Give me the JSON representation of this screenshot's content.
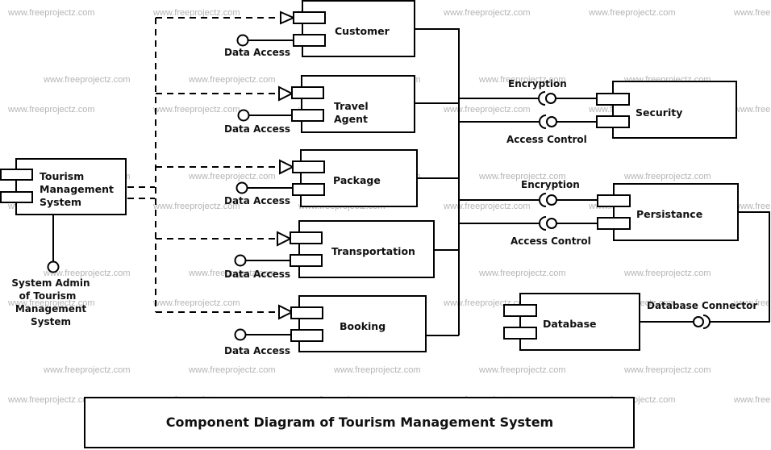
{
  "diagram": {
    "title": "Component Diagram of Tourism Management System",
    "watermark": "www.freeprojectz.com",
    "colors": {
      "line": "#000000",
      "background": "#ffffff",
      "watermark": "#b5b5b5"
    },
    "system": {
      "name_lines": [
        "Tourism",
        "Management",
        "System"
      ],
      "provided_interface_lines": [
        "System Admin",
        "of Tourism",
        "Management",
        "System"
      ]
    },
    "modules": [
      {
        "id": "customer",
        "name_lines": [
          "Customer"
        ],
        "interface": "Data Access"
      },
      {
        "id": "travel-agent",
        "name_lines": [
          "Travel",
          "Agent"
        ],
        "interface": "Data Access"
      },
      {
        "id": "package",
        "name_lines": [
          "Package"
        ],
        "interface": "Data Access"
      },
      {
        "id": "transportation",
        "name_lines": [
          "Transportation"
        ],
        "interface": "Data Access"
      },
      {
        "id": "booking",
        "name_lines": [
          "Booking"
        ],
        "interface": "Data Access"
      }
    ],
    "services": [
      {
        "id": "security",
        "name": "Security",
        "interfaces": [
          "Encryption",
          "Access Control"
        ]
      },
      {
        "id": "persistance",
        "name": "Persistance",
        "interfaces": [
          "Encryption",
          "Access Control"
        ]
      }
    ],
    "database": {
      "name": "Database",
      "interface": "Database Connector"
    }
  }
}
